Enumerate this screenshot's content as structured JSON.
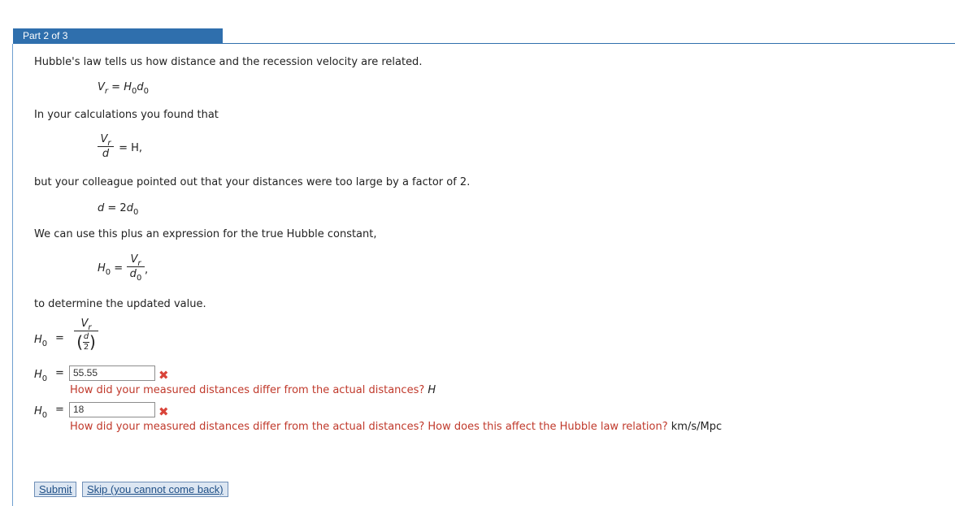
{
  "header": {
    "part_label": "Part 2 of 3"
  },
  "intro": "Hubble's law tells us how distance and the recession velocity are related.",
  "eq1": {
    "lhs_var": "V",
    "lhs_sub": "r",
    "eq": " = ",
    "h": "H",
    "h_sub": "0",
    "d": "d",
    "d_sub": "0"
  },
  "calc_text": "In your calculations you found that",
  "eq2": {
    "num_var": "V",
    "num_sub": "r",
    "den": "d",
    "rhs": " = H,"
  },
  "colleague_text": "but your colleague pointed out that your distances were too large by a factor of 2.",
  "eq3": {
    "lhs": "d",
    "mid": " = 2",
    "d": "d",
    "d_sub": "0"
  },
  "use_text": "We can use this plus an expression for the true Hubble constant,",
  "eq4": {
    "h": "H",
    "h_sub": "0",
    "eq": " = ",
    "num_var": "V",
    "num_sub": "r",
    "den_var": "d",
    "den_sub": "0",
    "trail": ","
  },
  "determine_text": "to determine the updated value.",
  "eq5": {
    "h": "H",
    "h_sub": "0",
    "eq": "=",
    "num_var": "V",
    "num_sub": "r",
    "inner_num": "d",
    "inner_den": "2"
  },
  "answer1": {
    "h": "H",
    "h_sub": "0",
    "eq": "=",
    "value": "55.55",
    "feedback": "How did your measured distances differ from the actual distances?",
    "unit": "H"
  },
  "answer2": {
    "h": "H",
    "h_sub": "0",
    "eq": "=",
    "value": "18",
    "feedback": "How did your measured distances differ from the actual distances? How does this affect the Hubble law relation?",
    "unit": "km/s/Mpc"
  },
  "buttons": {
    "submit": "Submit",
    "skip": "Skip (you cannot come back)"
  },
  "colors": {
    "accent": "#2f6fad",
    "error": "#c0392b",
    "x_mark": "#d9443a"
  }
}
